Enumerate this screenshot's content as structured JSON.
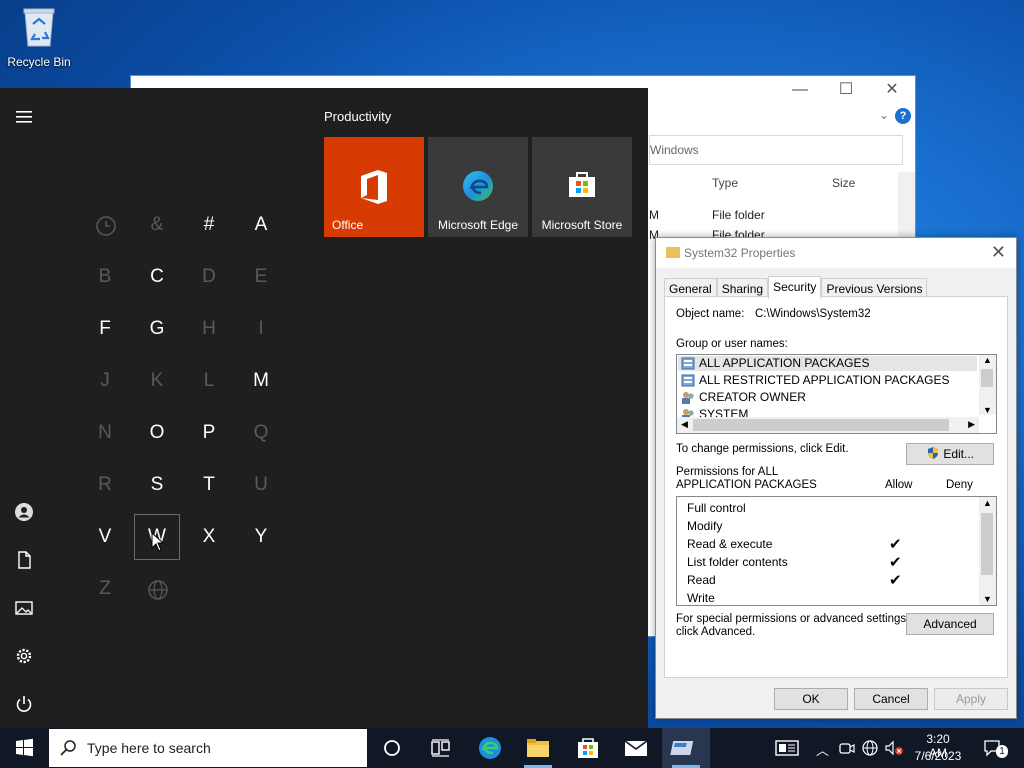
{
  "desktop": {
    "recycle_bin_label": "Recycle Bin"
  },
  "explorer": {
    "address_value": "Windows",
    "col_type": "Type",
    "col_size": "Size",
    "rows": [
      {
        "modified": "M",
        "type": "File folder"
      },
      {
        "modified": "M",
        "type": "File folder"
      }
    ],
    "controls": {
      "minimize": "—",
      "maximize": "☐",
      "close": "✕"
    },
    "help": "?"
  },
  "start_menu": {
    "group_title": "Productivity",
    "tiles": [
      {
        "label": "Office",
        "color": "#d83b01"
      },
      {
        "label": "Microsoft Edge",
        "color": "#3a3a3a"
      },
      {
        "label": "Microsoft Store",
        "color": "#3a3a3a"
      }
    ],
    "letters": [
      {
        "ch": "&",
        "dim": true
      },
      {
        "ch": "#",
        "dim": false
      },
      {
        "ch": "A",
        "dim": false
      },
      {
        "ch": "B",
        "dim": true
      },
      {
        "ch": "C",
        "dim": false
      },
      {
        "ch": "D",
        "dim": true
      },
      {
        "ch": "E",
        "dim": true
      },
      {
        "ch": "F",
        "dim": false
      },
      {
        "ch": "G",
        "dim": false
      },
      {
        "ch": "H",
        "dim": true
      },
      {
        "ch": "I",
        "dim": true
      },
      {
        "ch": "J",
        "dim": true
      },
      {
        "ch": "K",
        "dim": true
      },
      {
        "ch": "L",
        "dim": true
      },
      {
        "ch": "M",
        "dim": false
      },
      {
        "ch": "N",
        "dim": true
      },
      {
        "ch": "O",
        "dim": false
      },
      {
        "ch": "P",
        "dim": false
      },
      {
        "ch": "Q",
        "dim": true
      },
      {
        "ch": "R",
        "dim": true
      },
      {
        "ch": "S",
        "dim": false
      },
      {
        "ch": "T",
        "dim": false
      },
      {
        "ch": "U",
        "dim": true
      },
      {
        "ch": "V",
        "dim": false
      },
      {
        "ch": "W",
        "dim": false
      },
      {
        "ch": "X",
        "dim": false
      },
      {
        "ch": "Y",
        "dim": false
      },
      {
        "ch": "Z",
        "dim": true
      }
    ]
  },
  "properties": {
    "title": "System32 Properties",
    "close": "✕",
    "tabs": [
      "General",
      "Sharing",
      "Security",
      "Previous Versions"
    ],
    "active_tab": "Security",
    "object_name_label": "Object name:",
    "object_name_value": "C:\\Windows\\System32",
    "group_label": "Group or user names:",
    "groups": [
      "ALL APPLICATION PACKAGES",
      "ALL RESTRICTED APPLICATION PACKAGES",
      "CREATOR OWNER",
      "SYSTEM"
    ],
    "change_text": "To change permissions, click Edit.",
    "edit_button": "Edit...",
    "perm_label_line1": "Permissions for ALL",
    "perm_label_line2": "APPLICATION PACKAGES",
    "allow_label": "Allow",
    "deny_label": "Deny",
    "permissions": [
      {
        "name": "Full control",
        "allow": false
      },
      {
        "name": "Modify",
        "allow": false
      },
      {
        "name": "Read & execute",
        "allow": true
      },
      {
        "name": "List folder contents",
        "allow": true
      },
      {
        "name": "Read",
        "allow": true
      },
      {
        "name": "Write",
        "allow": false
      }
    ],
    "check_glyph": "✔",
    "special_line1": "For special permissions or advanced settings,",
    "special_line2": "click Advanced.",
    "advanced_button": "Advanced",
    "ok_button": "OK",
    "cancel_button": "Cancel",
    "apply_button": "Apply"
  },
  "taskbar": {
    "search_placeholder": "Type here to search",
    "time": "3:20 AM",
    "date": "7/6/2023",
    "notification_count": "1"
  }
}
